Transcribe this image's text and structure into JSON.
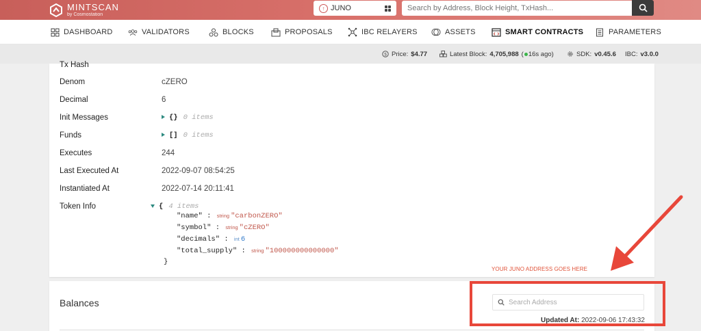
{
  "header": {
    "logo_title": "MINTSCAN",
    "logo_sub": "by Cosmostation",
    "chain": "JUNO",
    "search_placeholder": "Search by Address, Block Height, TxHash..."
  },
  "nav": {
    "items": [
      {
        "label": "DASHBOARD",
        "icon": "dashboard-icon"
      },
      {
        "label": "VALIDATORS",
        "icon": "validators-icon"
      },
      {
        "label": "BLOCKS",
        "icon": "blocks-icon"
      },
      {
        "label": "PROPOSALS",
        "icon": "proposals-icon"
      },
      {
        "label": "IBC RELAYERS",
        "icon": "ibc-icon"
      },
      {
        "label": "ASSETS",
        "icon": "assets-icon"
      },
      {
        "label": "SMART CONTRACTS",
        "icon": "contracts-icon"
      },
      {
        "label": "PARAMETERS",
        "icon": "parameters-icon"
      }
    ],
    "active": "SMART CONTRACTS"
  },
  "status": {
    "price_label": "Price:",
    "price": "$4.77",
    "block_label": "Latest Block:",
    "block": "4,705,988",
    "block_ago": "16s ago",
    "sdk_label": "SDK:",
    "sdk": "v0.45.6",
    "ibc_label": "IBC:",
    "ibc": "v3.0.0"
  },
  "contract": {
    "cut_label": "Tx Hash",
    "rows": [
      {
        "label": "Denom",
        "value": "cZERO"
      },
      {
        "label": "Decimal",
        "value": "6"
      },
      {
        "label": "Init Messages",
        "value": "{}",
        "items": "0 items"
      },
      {
        "label": "Funds",
        "value": "[]",
        "items": "0 items"
      },
      {
        "label": "Executes",
        "value": "244"
      },
      {
        "label": "Last Executed At",
        "value": "2022-09-07 08:54:25"
      },
      {
        "label": "Instantiated At",
        "value": "2022-07-14 20:11:41"
      },
      {
        "label": "Token Info",
        "value": "{",
        "items": "4 items"
      }
    ],
    "token_info": [
      {
        "key": "\"name\"",
        "type": "string",
        "value": "\"carbonZERO\""
      },
      {
        "key": "\"symbol\"",
        "type": "string",
        "value": "\"cZERO\""
      },
      {
        "key": "\"decimals\"",
        "type": "int",
        "value": "6"
      },
      {
        "key": "\"total_supply\"",
        "type": "string",
        "value": "\"100000000000000\""
      }
    ],
    "token_close": "}"
  },
  "annotation": {
    "text": "YOUR JUNO ADDRESS GOES HERE",
    "color": "#e8473a"
  },
  "balances": {
    "title": "Balances",
    "search_placeholder": "Search Address",
    "updated_label": "Updated At:",
    "updated_value": "2022-09-06 17:43:32"
  }
}
